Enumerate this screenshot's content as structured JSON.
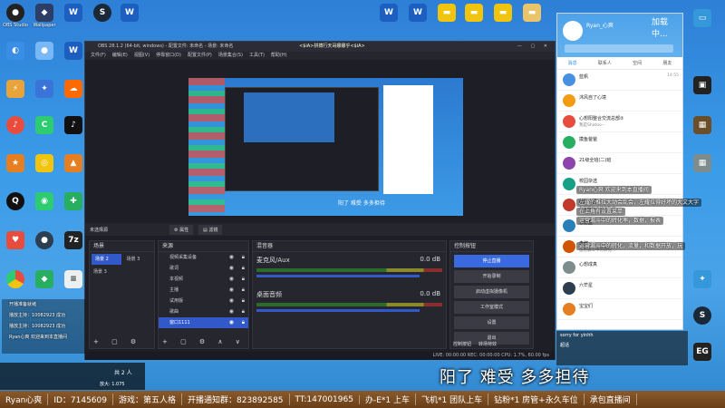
{
  "desktop_icons": [
    {
      "label": "OBS Studio",
      "color": "#333"
    },
    {
      "label": "Wallpaper",
      "color": "#2c3e66"
    },
    {
      "label": "",
      "color": "#1a1a1a"
    },
    {
      "label": "",
      "color": "#1d4ea0"
    },
    {
      "label": "",
      "color": "#1c5ec1"
    },
    {
      "label": "",
      "color": "#e8a33a"
    },
    {
      "label": "",
      "color": "#3a74d8"
    },
    {
      "label": "",
      "color": "#e74c3c"
    },
    {
      "label": "",
      "color": "#2ecc71"
    },
    {
      "label": "",
      "color": "#111"
    }
  ],
  "obs": {
    "title": "OBS 28.1.2 (64-bit, windows) - 配置文件: 未命名 - 场景: 未命名",
    "banner": "<$iA>拼搏行天哥娜娜乎<$iA>",
    "menu": [
      "文件(F)",
      "编辑(E)",
      "视图(V)",
      "停靠窗口(D)",
      "配置文件(P)",
      "场景集合(S)",
      "工具(T)",
      "帮助(H)"
    ],
    "preview_subtitle": "阳了 难受 多多担待",
    "no_source_selected": "未选择源",
    "properties_btn": "属性",
    "filters_btn": "滤镜",
    "scenes_title": "场景",
    "scenes": [
      "场景 2",
      "场景 3",
      "场景 3"
    ],
    "sources_title": "来源",
    "sources": [
      "视频采集设备",
      "歌词",
      "本视频",
      "主播",
      "试用版",
      "歌曲",
      "窗口1111"
    ],
    "mixer_title": "混音器",
    "mixer": [
      {
        "name": "麦克风/Aux",
        "db": "0.0 dB"
      },
      {
        "name": "桌面音频",
        "db": "0.0 dB"
      }
    ],
    "controls_title": "控制按钮",
    "controls": [
      "停止直播",
      "开始录制",
      "启动虚拟摄像机",
      "工作室模式",
      "设置",
      "退出"
    ],
    "bottom_tabs": [
      "控制按钮",
      "转场特效"
    ],
    "status": "LIVE: 00:00:00    REC: 00:00:00    CPU: 1.7%, 60.00 fps"
  },
  "qq": {
    "user": "Ryan_心爽",
    "tabs": [
      "消息",
      "联系人",
      "空间",
      "朋友"
    ],
    "chats": [
      {
        "name": "蓝帆",
        "msg": "",
        "time": "14:55",
        "color": "#4a90e2"
      },
      {
        "name": "沐风自了心境",
        "msg": "",
        "time": "",
        "color": "#f39c12"
      },
      {
        "name": "心想阳整合交流总部②",
        "msg": "我是Shatoo--",
        "time": "",
        "color": "#e74c3c"
      },
      {
        "name": "摸鱼爸爸",
        "msg": "",
        "time": "",
        "color": "#27ae60"
      },
      {
        "name": "21级全班(二)班",
        "msg": "",
        "time": "",
        "color": "#8e44ad"
      },
      {
        "name": "校园杂选",
        "msg": "",
        "time": "",
        "color": "#16a085"
      },
      {
        "name": "乾苒沁园",
        "msg": "左旋推拉大动会乱会",
        "time": "",
        "color": "#c0392b"
      },
      {
        "name": "心愿盒",
        "msg": "",
        "time": "",
        "color": "#2980b9"
      },
      {
        "name": "森酱",
        "msg": "运营漏斗中的转化...",
        "time": "",
        "color": "#d35400"
      },
      {
        "name": "心想成真",
        "msg": "",
        "time": "",
        "color": "#7f8c8d"
      },
      {
        "name": "六芒星",
        "msg": "",
        "time": "",
        "color": "#2c3e50"
      },
      {
        "name": "宝宝们",
        "msg": "",
        "time": "",
        "color": "#e67e22"
      }
    ],
    "loading": "加载中..."
  },
  "chat_overlay": [
    "Ryan心爽  欢迎来到本直播间",
    "左耀的推拉大动会乱会，左耀拉得好坏的大文大字",
    "在上角有设置菜单",
    "运营漏斗中的转化率，数据，报表",
    "运营漏斗中的转化，流量，和数据开放，玩"
  ],
  "left_chat": [
    "开播准备就绪",
    "播放主持：10082923 成功",
    "播放主持：10082923 成功",
    "Ryan心爽  欢迎来到本直播间"
  ],
  "viewer_count": "共 2 人",
  "zoom": "放大: 1.075",
  "big_subtitle": "阳了 难受 多多担待",
  "ticker": [
    "Ryan心爽",
    "ID：7145609",
    "游戏：第五人格",
    "开播通知群：823892585",
    "TT:147001965",
    "办-E*1 上车",
    "飞机*1 团队上车",
    "钻粉*1 房管+永久车位",
    "承包直播间"
  ],
  "bottom_right_overlay": [
    "sorry for yinhh",
    "超话"
  ]
}
